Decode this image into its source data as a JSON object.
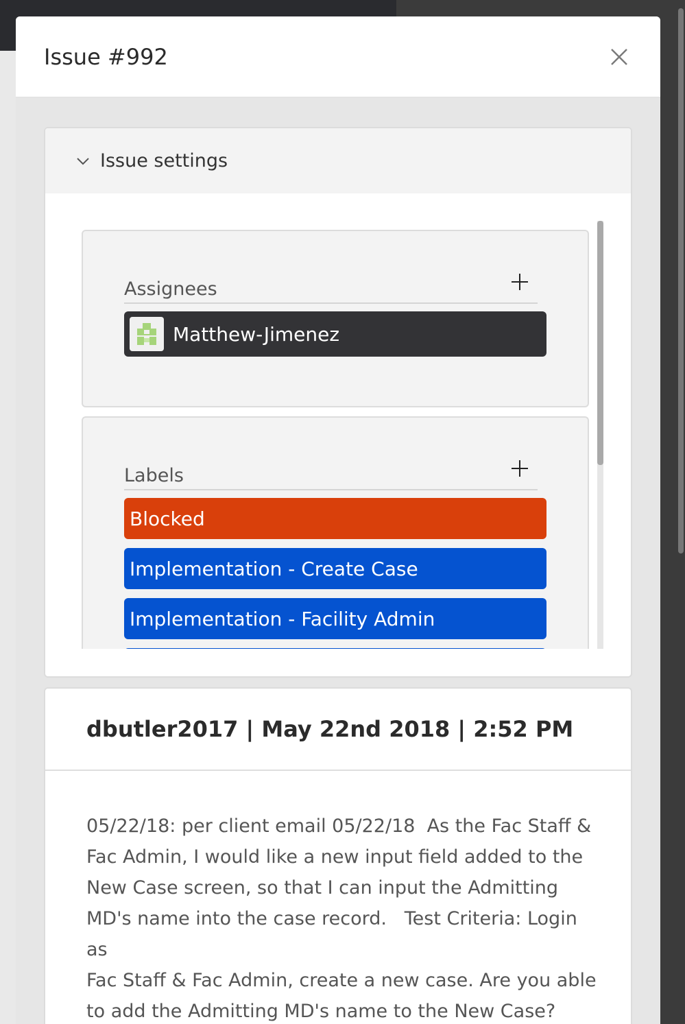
{
  "modal": {
    "title": "Issue #992",
    "close_icon": "close-icon"
  },
  "settings": {
    "header_label": "Issue settings",
    "expanded": true,
    "assignees": {
      "title": "Assignees",
      "items": [
        {
          "name": "Matthew-Jimenez",
          "avatar": "identicon"
        }
      ]
    },
    "labels": {
      "title": "Labels",
      "items": [
        {
          "name": "Blocked",
          "color": "#d9400b"
        },
        {
          "name": "Implementation - Create Case",
          "color": "#0553d0"
        },
        {
          "name": "Implementation - Facility Admin",
          "color": "#0553d0"
        },
        {
          "name": "",
          "color": "#0553d0"
        }
      ]
    }
  },
  "comment": {
    "meta": "dbutler2017 | May 22nd 2018 | 2:52 PM",
    "body": "05/22/18: per client email 05/22/18  As the Fac Staff &\nFac Admin, I would like a new input field added to the\nNew Case screen, so that I can input the Admitting\nMD's name into the case record.   Test Criteria: Login as\nFac Staff & Fac Admin, create a new case. Are you able\nto add the Admitting MD's name to the New Case?"
  }
}
